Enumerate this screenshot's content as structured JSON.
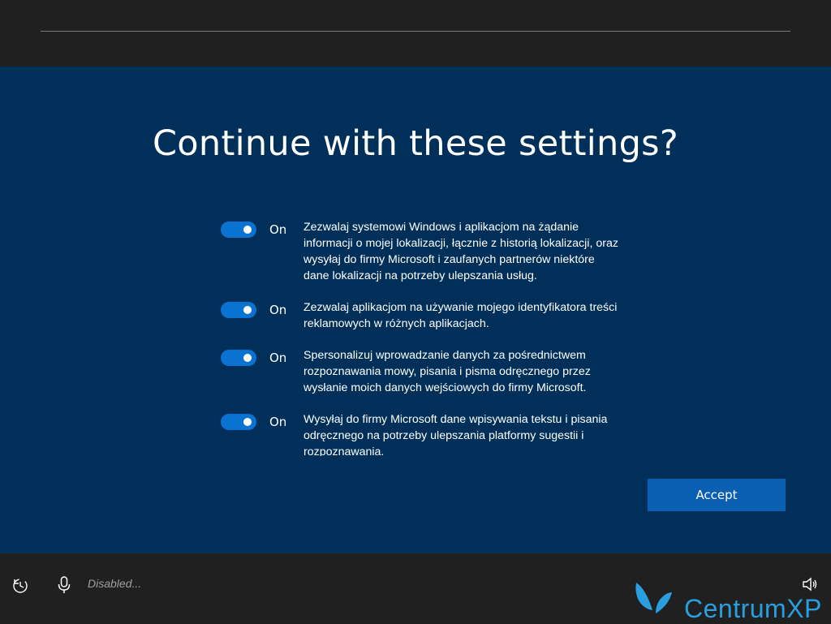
{
  "title": "Continue with these settings?",
  "settings": [
    {
      "state": "On",
      "description": "Zezwalaj systemowi Windows i aplikacjom na żądanie informacji o mojej lokalizacji, łącznie z historią lokalizacji, oraz wysyłaj do firmy Microsoft i zaufanych partnerów niektóre dane lokalizacji na potrzeby ulepszania usług."
    },
    {
      "state": "On",
      "description": "Zezwalaj aplikacjom na używanie mojego identyfikatora treści reklamowych w różnych aplikacjach."
    },
    {
      "state": "On",
      "description": "Spersonalizuj wprowadzanie danych za pośrednictwem rozpoznawania mowy, pisania i pisma odręcznego przez wysłanie moich danych wejściowych do firmy Microsoft."
    },
    {
      "state": "On",
      "description": "Wysyłaj do firmy Microsoft dane wpisywania tekstu i pisania odręcznego na potrzeby ulepszania platformy sugestii i rozpoznawania."
    }
  ],
  "accept_label": "Accept",
  "bottom": {
    "mic_status": "Disabled...",
    "icons": [
      "ease-of-access-icon",
      "microphone-icon",
      "volume-icon"
    ]
  },
  "watermark": {
    "text": "CentrumXP"
  },
  "colors": {
    "accent": "#0a72d0",
    "background": "#003059",
    "button": "#0a5fb2",
    "bar": "#202020"
  }
}
